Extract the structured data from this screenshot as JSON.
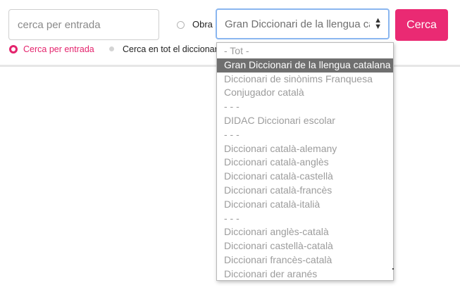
{
  "search": {
    "placeholder": "cerca per entrada",
    "button_label": "Cerca"
  },
  "obra": {
    "label": "Obra",
    "selected": "Gran Diccionari de la llengua catalana"
  },
  "search_modes": [
    {
      "label": "Cerca per entrada",
      "checked": true
    },
    {
      "label": "Cerca en tot el diccionari",
      "checked": false
    }
  ],
  "dropdown": {
    "options": [
      "- Tot -",
      "Gran Diccionari de la llengua catalana",
      "Diccionari de sinònims Franquesa",
      "Conjugador català",
      "- - -",
      "DIDAC Diccionari escolar",
      "- - -",
      "Diccionari català-alemany",
      "Diccionari català-anglès",
      "Diccionari català-castellà",
      "Diccionari català-francès",
      "Diccionari català-italià",
      "- - -",
      "Diccionari anglès-català",
      "Diccionari castellà-català",
      "Diccionari francès-català",
      "Diccionari der aranés"
    ],
    "selected_index": 1
  },
  "colors": {
    "accent": "#ea2a73",
    "focus_border": "#8ab6f0",
    "selected_option_bg": "#6f6f6f"
  },
  "icons": {
    "select_caret": "sort-caret-icon"
  }
}
